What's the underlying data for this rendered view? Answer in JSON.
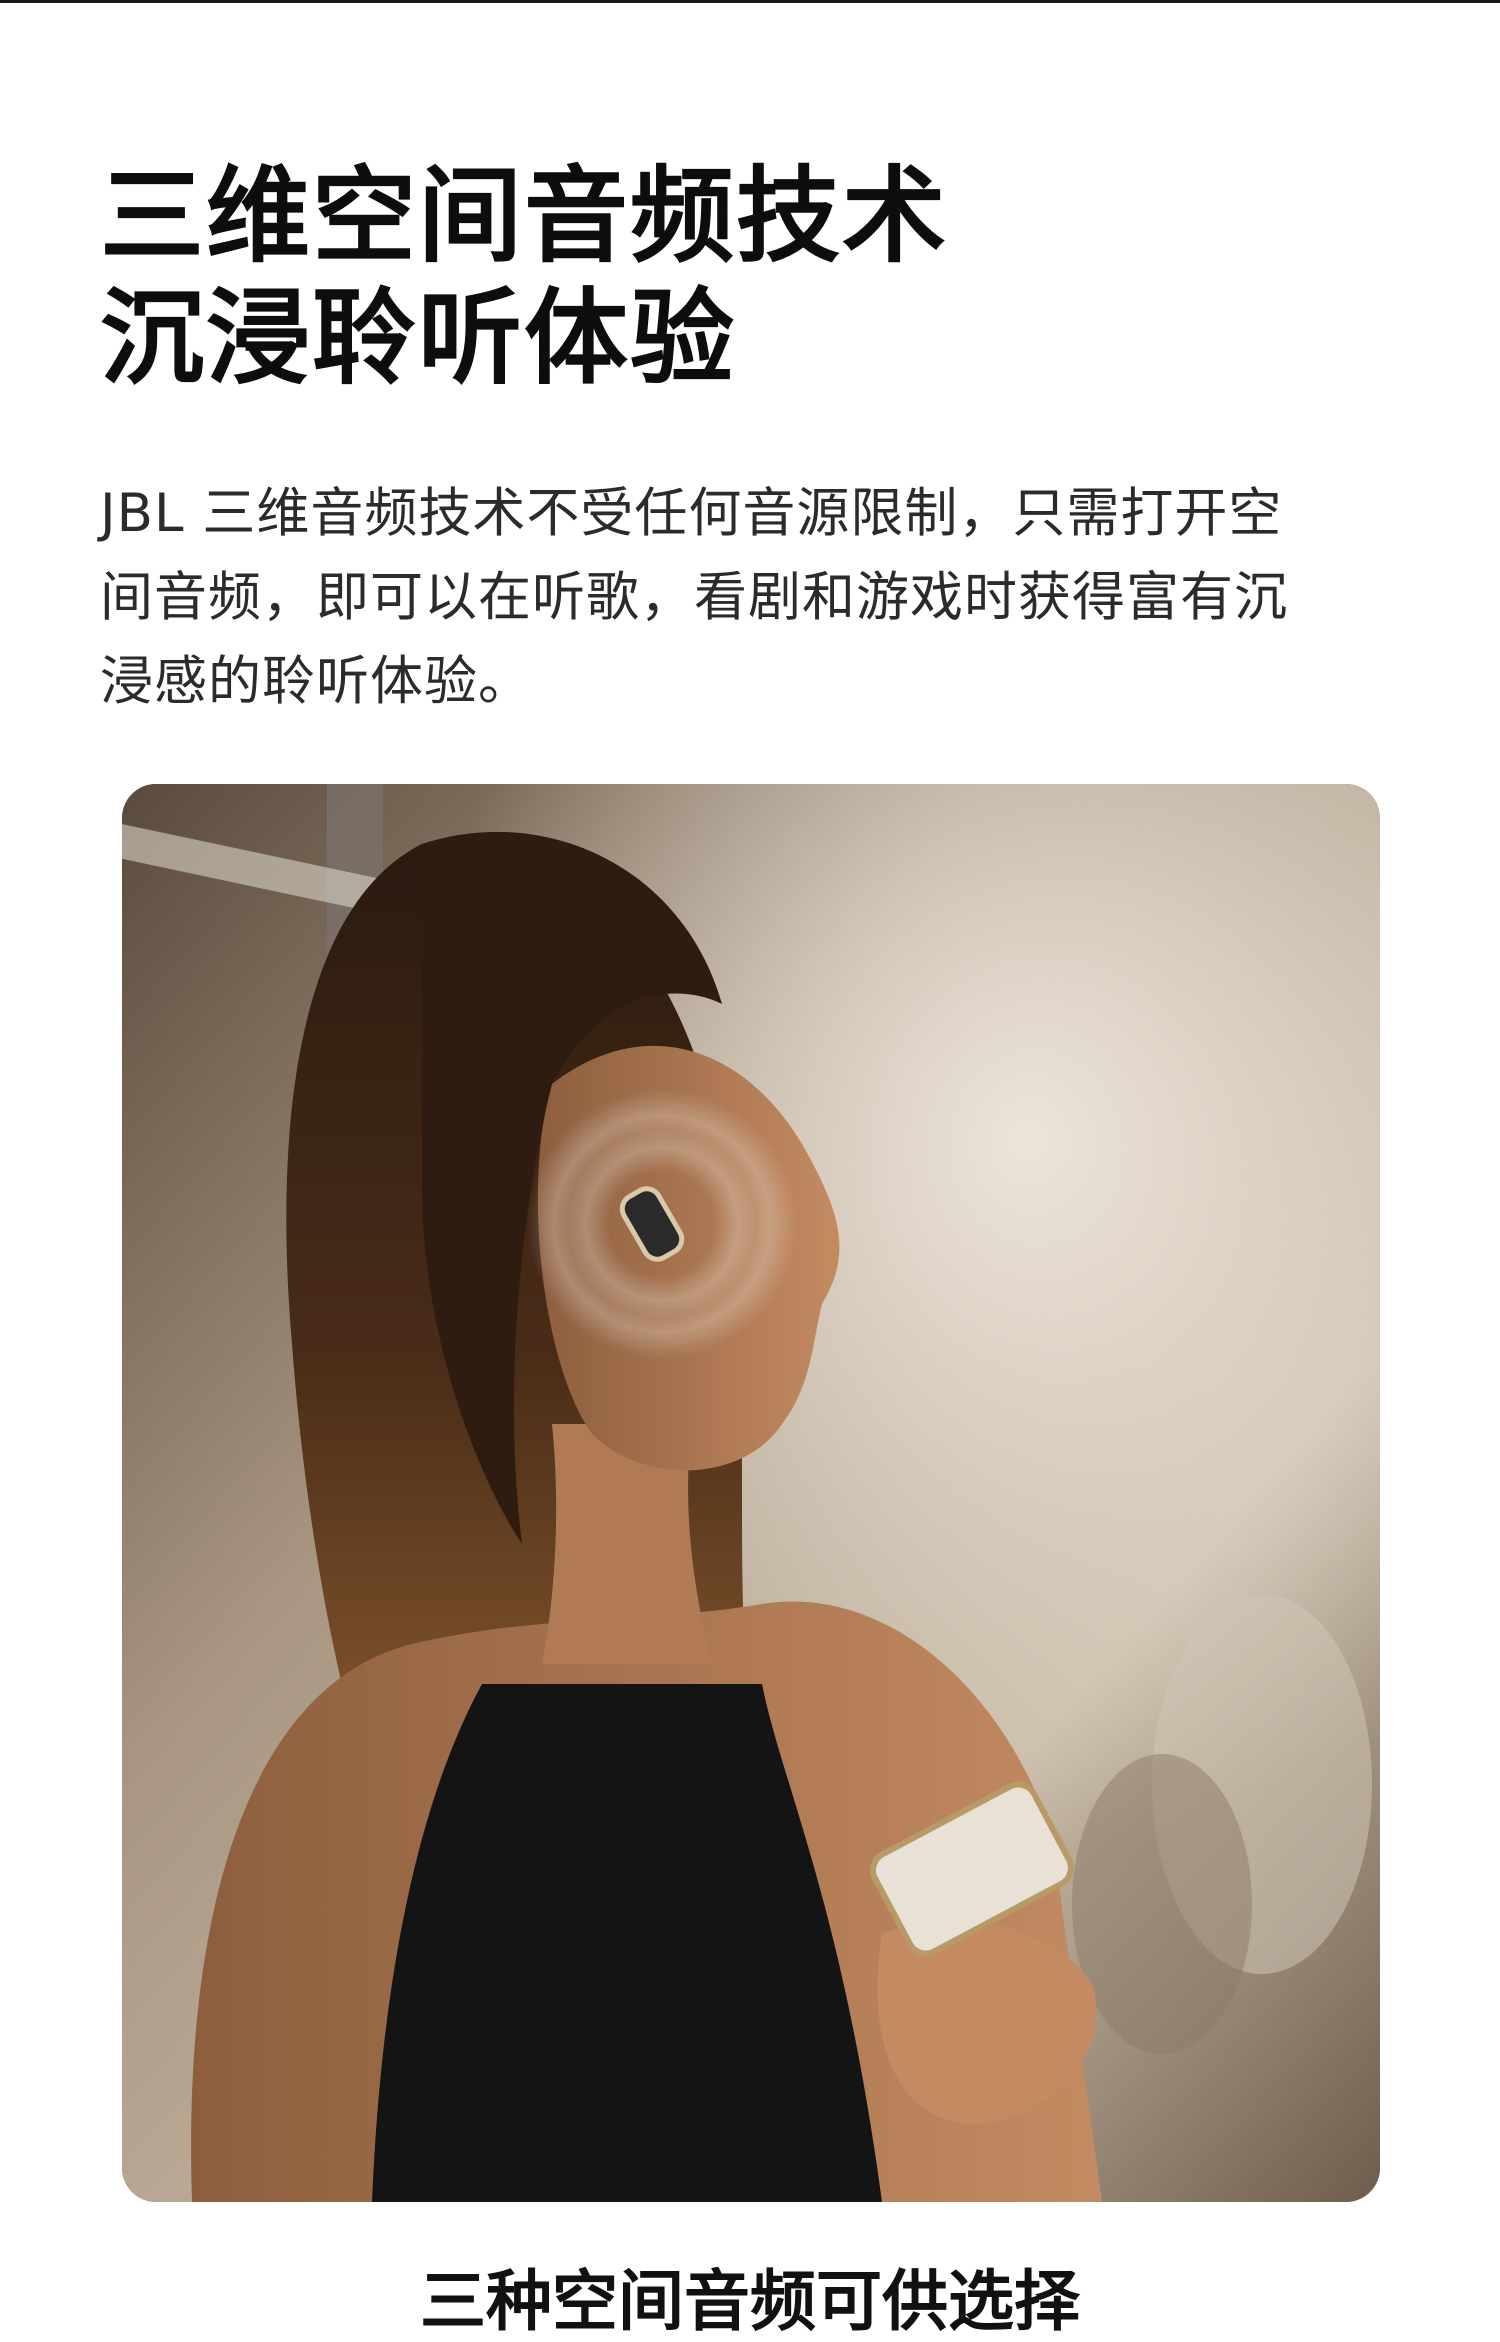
{
  "headline": {
    "line1": "三维空间音频技术",
    "line2": "沉浸聆听体验"
  },
  "description": {
    "line1": "JBL 三维音频技术不受任何音源限制，只需打开空",
    "line2": "间音频，即可以在听歌，看剧和游戏时获得富有沉",
    "line3": "浸感的聆听体验。"
  },
  "next_section_title": "三种空间音频可供选择",
  "colors": {
    "background": "#ffffff",
    "heading": "#0d0d0d",
    "body": "#2b2b2b"
  }
}
